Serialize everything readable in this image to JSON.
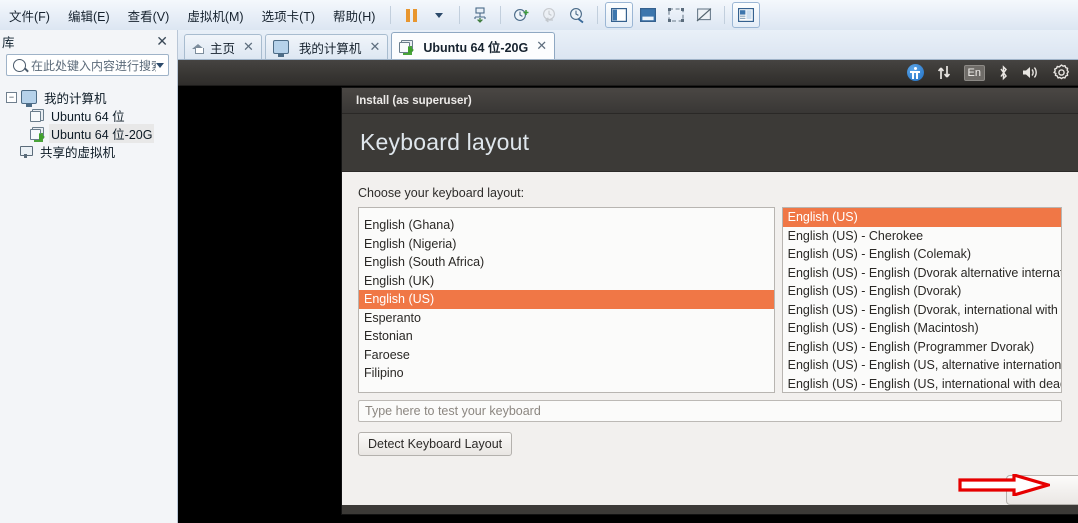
{
  "app": {
    "menu": [
      {
        "label": "文件(F)"
      },
      {
        "label": "编辑(E)"
      },
      {
        "label": "查看(V)"
      },
      {
        "label": "虚拟机(M)"
      },
      {
        "label": "选项卡(T)"
      },
      {
        "label": "帮助(H)"
      }
    ],
    "toolbar": [
      {
        "name": "pause-vm-button",
        "icon": "pause-icon"
      },
      {
        "name": "power-dropdown-button",
        "icon": "caret-down-icon"
      },
      {
        "name": "manage-snapshots-button",
        "icon": "snapshot-manager-icon"
      },
      {
        "name": "take-snapshot-button",
        "icon": "snapshot-add-icon"
      },
      {
        "name": "revert-snapshot-button",
        "icon": "snapshot-revert-icon"
      },
      {
        "name": "snapshot-settings-button",
        "icon": "snapshot-settings-icon"
      },
      {
        "name": "show-library-button",
        "icon": "sidebar-panel-icon"
      },
      {
        "name": "console-view-button",
        "icon": "console-view-icon"
      },
      {
        "name": "fullscreen-button",
        "icon": "fullscreen-icon"
      },
      {
        "name": "unity-mode-button",
        "icon": "unity-mode-icon"
      },
      {
        "name": "thumbnail-bar-button",
        "icon": "thumbnail-bar-icon"
      }
    ]
  },
  "sidebar": {
    "title": "库",
    "close_label": "✕",
    "search": {
      "placeholder": "在此处键入内容进行搜索",
      "value": ""
    },
    "tree": [
      {
        "label": "我的计算机",
        "icon": "monitor-icon",
        "level": 1,
        "expanded": true,
        "twisty": "−"
      },
      {
        "label": "Ubuntu 64 位",
        "icon": "vm-icon",
        "level": 2,
        "running": false
      },
      {
        "label": "Ubuntu 64 位-20G",
        "icon": "vm-icon",
        "level": 2,
        "running": true,
        "selected": true
      },
      {
        "label": "共享的虚拟机",
        "icon": "shared-vm-icon",
        "level": 1
      }
    ]
  },
  "tabs": [
    {
      "label": "主页",
      "icon": "home-icon",
      "active": false,
      "close": "✕"
    },
    {
      "label": "我的计算机",
      "icon": "monitor-icon",
      "active": false,
      "close": "✕"
    },
    {
      "label": "Ubuntu 64 位-20G",
      "icon": "vm-icon",
      "active": true,
      "close": "✕"
    }
  ],
  "guest_panel": {
    "indicators": [
      {
        "name": "accessibility-icon",
        "glyph": ""
      },
      {
        "name": "network-icon",
        "glyph": "⇅"
      },
      {
        "name": "keyboard-layout-indicator",
        "glyph": "En"
      },
      {
        "name": "bluetooth-icon",
        "glyph": "✻"
      },
      {
        "name": "volume-icon",
        "glyph": "🔊"
      },
      {
        "name": "system-settings-icon",
        "glyph": "⚙"
      }
    ]
  },
  "installer": {
    "window_title": "Install (as superuser)",
    "heading": "Keyboard layout",
    "choose_label": "Choose your keyboard layout:",
    "layouts": [
      "English (Ghana)",
      "English (Nigeria)",
      "English (South Africa)",
      "English (UK)",
      "English (US)",
      "Esperanto",
      "Estonian",
      "Faroese",
      "Filipino"
    ],
    "selected_layout": "English (US)",
    "variants": [
      "English (US)",
      "English (US) - Cherokee",
      "English (US) - English (Colemak)",
      "English (US) - English (Dvorak alternative international no dead keys)",
      "English (US) - English (Dvorak)",
      "English (US) - English (Dvorak, international with dead keys)",
      "English (US) - English (Macintosh)",
      "English (US) - English (Programmer Dvorak)",
      "English (US) - English (US, alternative international)",
      "English (US) - English (US, international with dead keys)"
    ],
    "selected_variant": "English (US)",
    "test_input_placeholder": "Type here to test your keyboard",
    "test_input_value": "",
    "detect_button": "Detect Keyboard Layout",
    "continue_button": "",
    "accent_color": "#f07746"
  },
  "annotation": {
    "arrow_color": "#e60000",
    "points_to": "continue-button"
  }
}
